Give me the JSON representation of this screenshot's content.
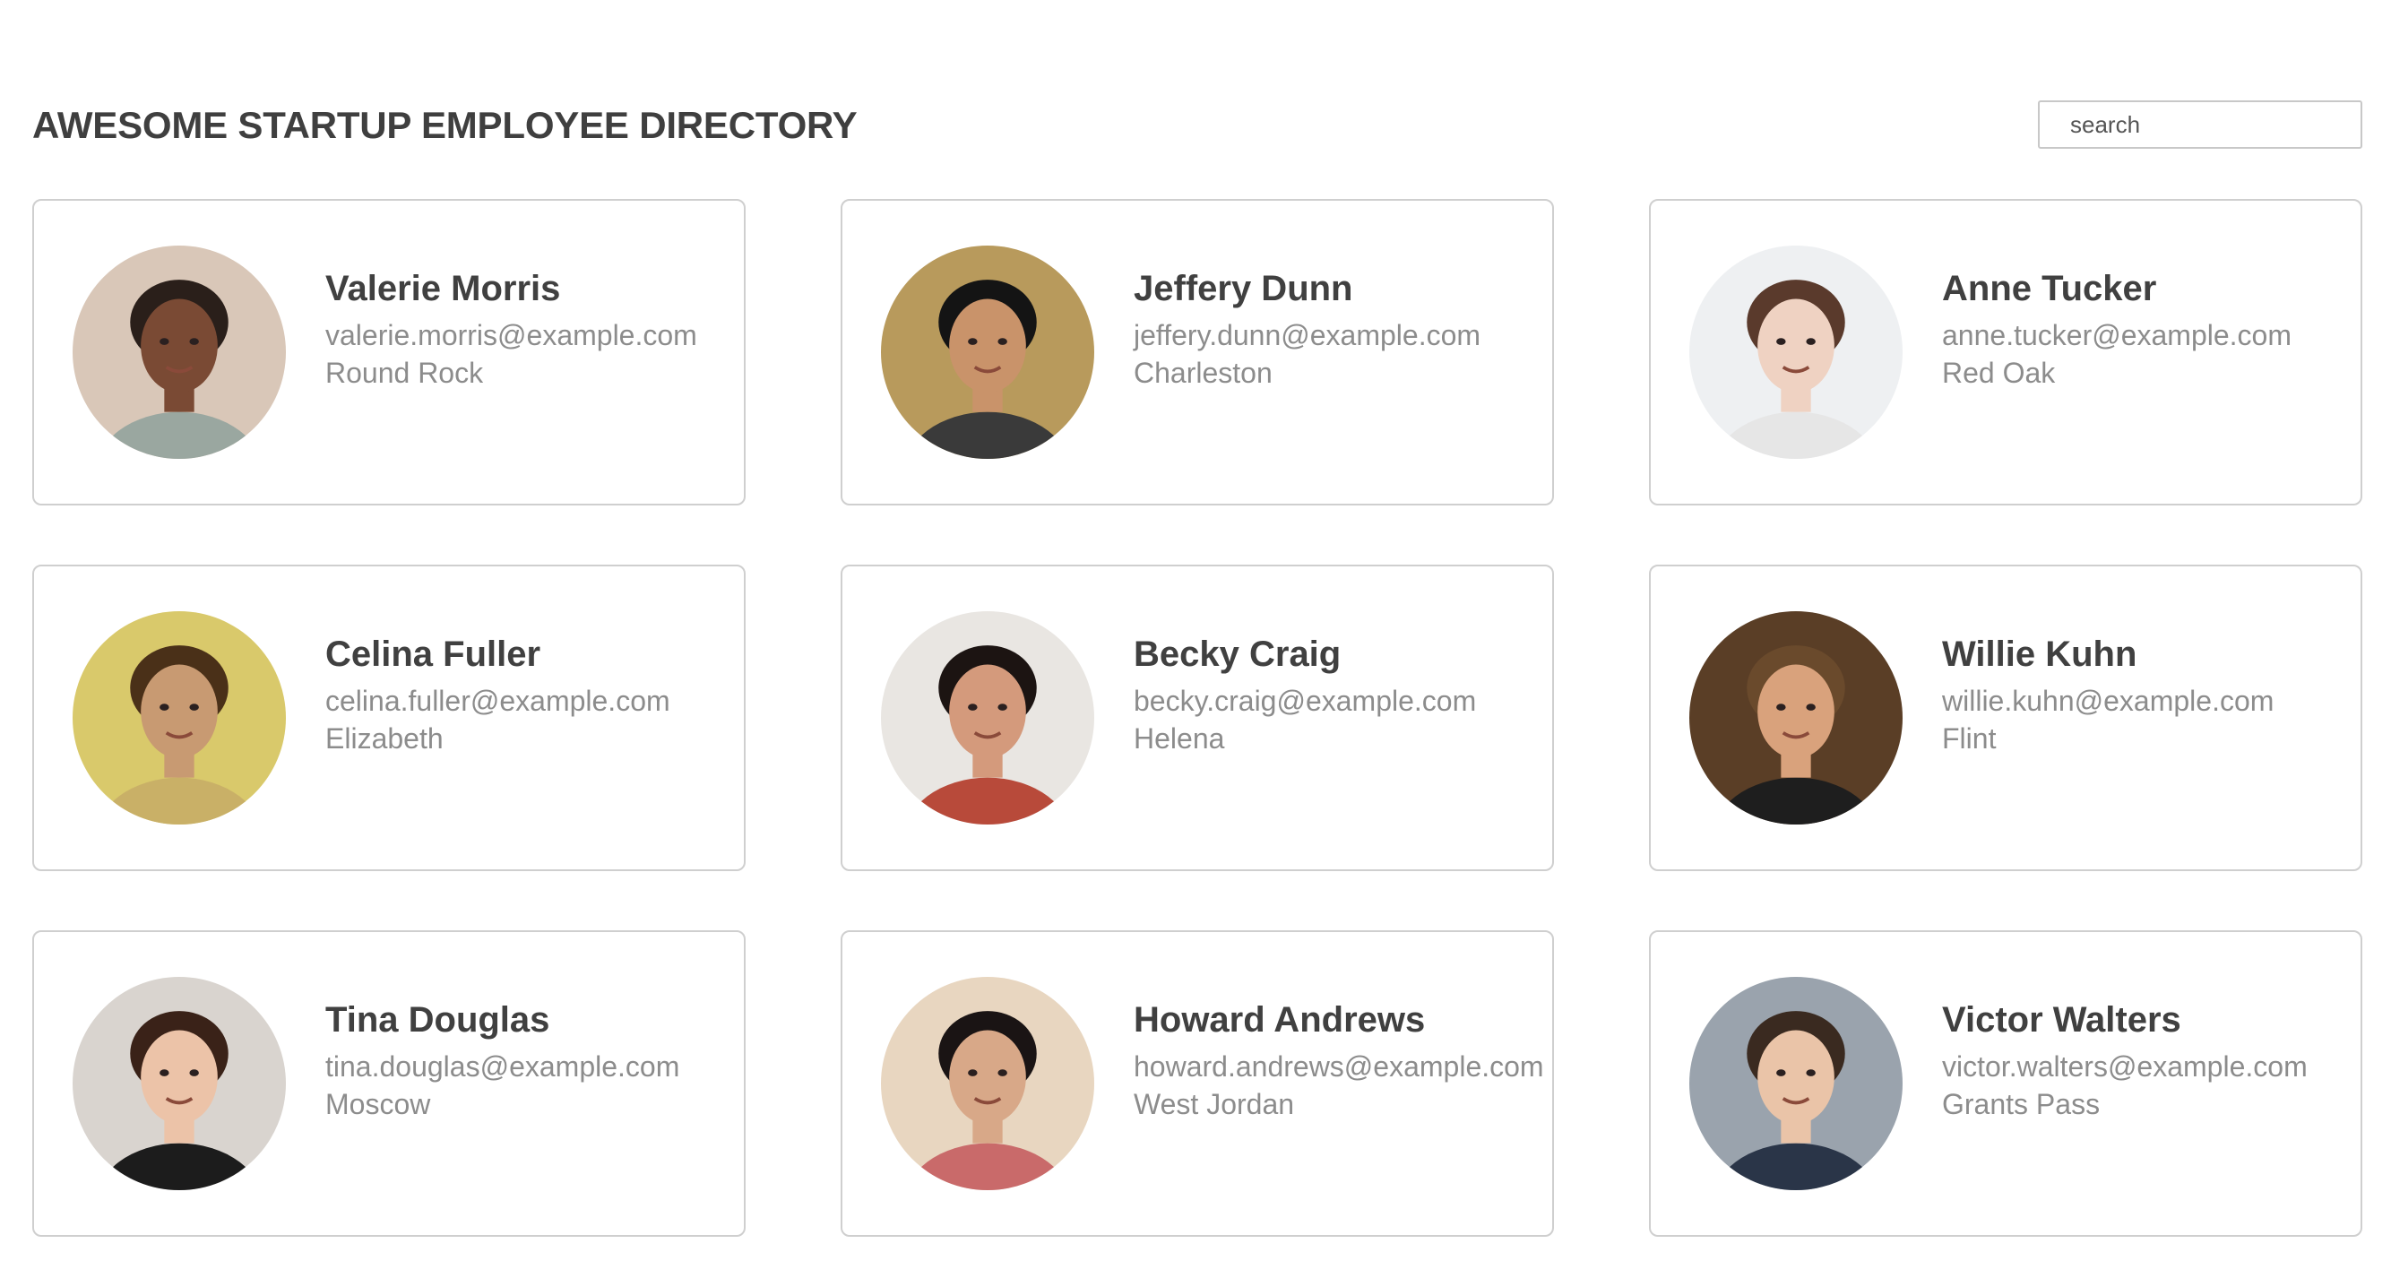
{
  "header": {
    "title": "AWESOME STARTUP EMPLOYEE DIRECTORY",
    "search_placeholder": "search"
  },
  "employees": [
    {
      "name": "Valerie Morris",
      "email": "valerie.morris@example.com",
      "city": "Round Rock",
      "avatar": {
        "bg": "#d9c7b8",
        "skin": "#7a4a34",
        "hair": "#2a1f1a",
        "shirt": "#9aa7a0"
      }
    },
    {
      "name": "Jeffery Dunn",
      "email": "jeffery.dunn@example.com",
      "city": "Charleston",
      "avatar": {
        "bg": "#b89a5c",
        "skin": "#c9936a",
        "hair": "#141414",
        "shirt": "#3a3a3a"
      }
    },
    {
      "name": "Anne Tucker",
      "email": "anne.tucker@example.com",
      "city": "Red Oak",
      "avatar": {
        "bg": "#eef0f2",
        "skin": "#efd2c2",
        "hair": "#5a3a2c",
        "shirt": "#e6e6e6"
      }
    },
    {
      "name": "Celina Fuller",
      "email": "celina.fuller@example.com",
      "city": "Elizabeth",
      "avatar": {
        "bg": "#d9c96b",
        "skin": "#c89a72",
        "hair": "#4a3018",
        "shirt": "#c9b067"
      }
    },
    {
      "name": "Becky Craig",
      "email": "becky.craig@example.com",
      "city": "Helena",
      "avatar": {
        "bg": "#e9e6e2",
        "skin": "#d49a7c",
        "hair": "#1c1412",
        "shirt": "#b84a3a"
      }
    },
    {
      "name": "Willie Kuhn",
      "email": "willie.kuhn@example.com",
      "city": "Flint",
      "avatar": {
        "bg": "#5a3e26",
        "skin": "#d9a27c",
        "hair": "#6a4a2c",
        "shirt": "#1e1e1e"
      }
    },
    {
      "name": "Tina Douglas",
      "email": "tina.douglas@example.com",
      "city": "Moscow",
      "avatar": {
        "bg": "#d9d4cf",
        "skin": "#ecc3a8",
        "hair": "#3a2218",
        "shirt": "#1c1c1c"
      }
    },
    {
      "name": "Howard Andrews",
      "email": "howard.andrews@example.com",
      "city": "West Jordan",
      "avatar": {
        "bg": "#e8d6c0",
        "skin": "#d8a888",
        "hair": "#1a1414",
        "shirt": "#c96a6a"
      }
    },
    {
      "name": "Victor Walters",
      "email": "victor.walters@example.com",
      "city": "Grants Pass",
      "avatar": {
        "bg": "#9aa3ad",
        "skin": "#eac4a8",
        "hair": "#3a2a20",
        "shirt": "#2a3548"
      }
    }
  ]
}
